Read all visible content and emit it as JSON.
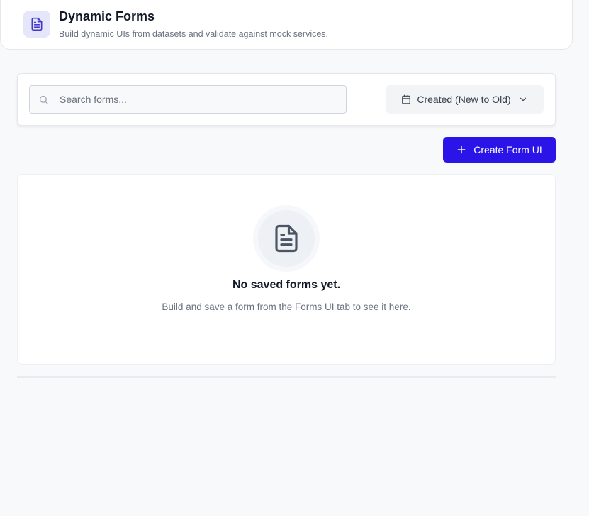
{
  "header": {
    "icon": "document-icon",
    "title": "Dynamic Forms",
    "subtitle": "Build dynamic UIs from datasets and validate against mock services."
  },
  "toolbar": {
    "search": {
      "placeholder": "Search forms...",
      "value": ""
    },
    "sort": {
      "icon": "calendar-icon",
      "label": "Created (New to Old)",
      "dropdown_icon": "chevron-down-icon"
    }
  },
  "actions": {
    "create_label": "Create Form UI",
    "create_icon": "plus-icon"
  },
  "empty_state": {
    "icon": "document-icon",
    "title": "No saved forms yet.",
    "text": "Build and save a form from the Forms UI tab to see it here."
  },
  "colors": {
    "primary": "#2b14e8",
    "icon_accent": "#4338ca",
    "background": "#f8f9fb"
  }
}
